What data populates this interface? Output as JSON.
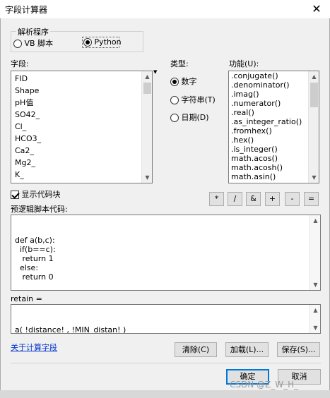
{
  "window": {
    "title": "字段计算器",
    "close_glyph": "✕"
  },
  "parser": {
    "group_label": "解析程序",
    "options": [
      {
        "label": "VB 脚本",
        "selected": false
      },
      {
        "label": "Python",
        "selected": true
      }
    ]
  },
  "fields": {
    "label": "字段:",
    "items": [
      "FID",
      "Shape",
      "pH值",
      "SO42_",
      "Cl_",
      "HCO3_",
      "Ca2_",
      "Mg2_",
      "K_"
    ]
  },
  "types": {
    "label": "类型:",
    "options": [
      {
        "label": "数字",
        "selected": true
      },
      {
        "label": "字符串(T)",
        "selected": false
      },
      {
        "label": "日期(D)",
        "selected": false
      }
    ]
  },
  "functions": {
    "label": "功能(U):",
    "items": [
      ".conjugate()",
      ".denominator()",
      ".imag()",
      ".numerator()",
      ".real()",
      ".as_integer_ratio()",
      ".fromhex()",
      ".hex()",
      ".is_integer()",
      "math.acos()",
      "math.acosh()",
      "math.asin()"
    ]
  },
  "show_codeblock": {
    "label": "显示代码块",
    "checked": true
  },
  "operators": [
    "*",
    "/",
    "&",
    "+",
    "-",
    "="
  ],
  "prelogic": {
    "label": "预逻辑脚本代码:",
    "code": "def a(b,c):\n  if(b==c):\n   return 1\n  else:\n   return 0"
  },
  "expression": {
    "label": "retain =",
    "value": "a( !distance! , !MIN_distan! )"
  },
  "about_link": "关于计算字段",
  "buttons": {
    "clear": "清除(C)",
    "load": "加载(L)...",
    "save": "保存(S)...",
    "ok": "确定",
    "cancel": "取消"
  },
  "watermark": "CSDN @Z_W_H_"
}
